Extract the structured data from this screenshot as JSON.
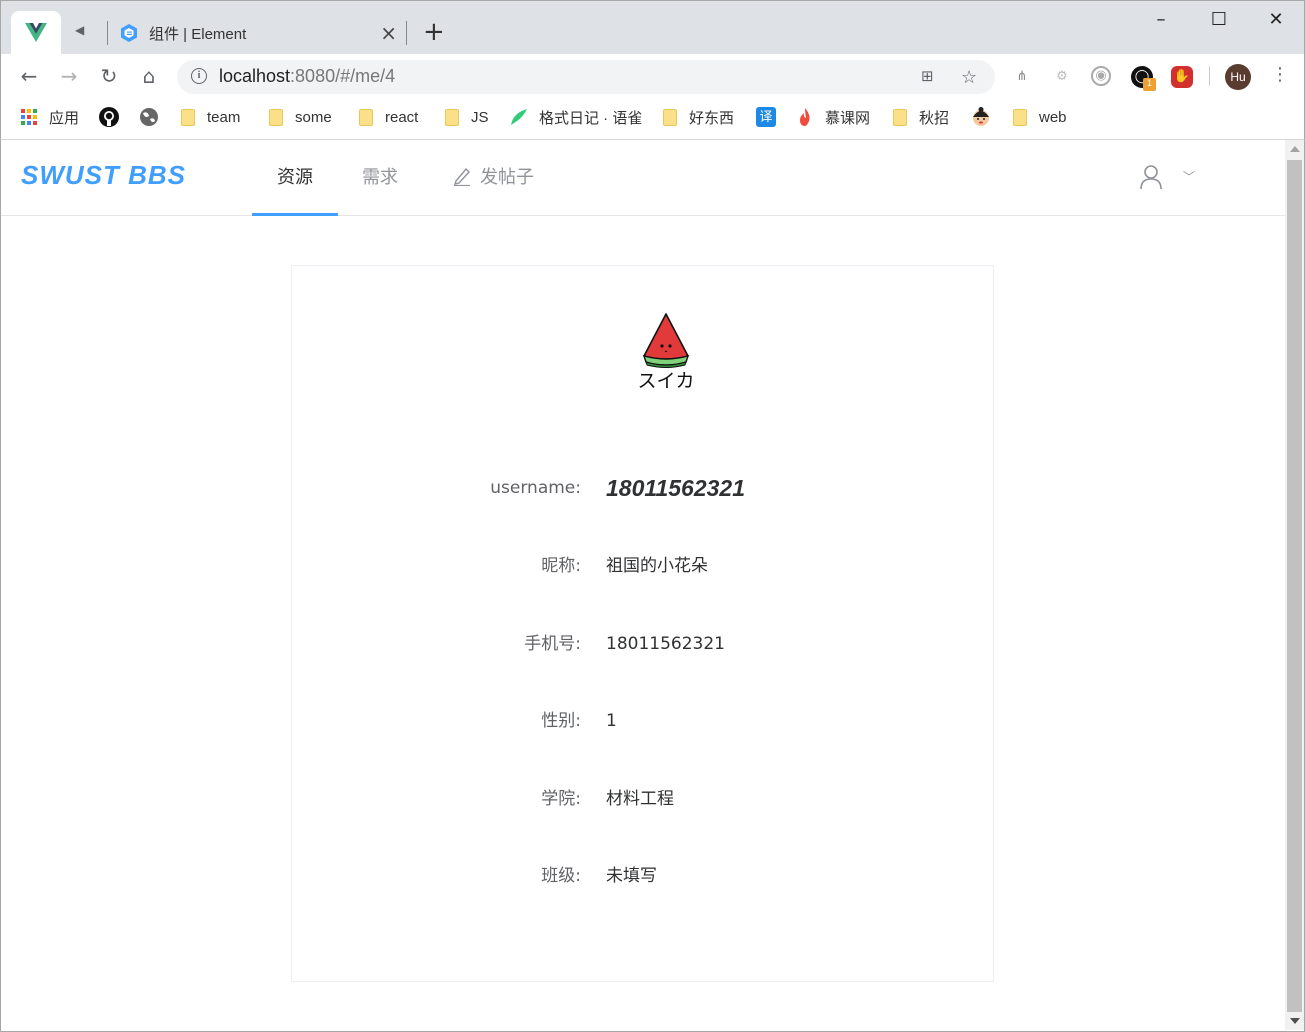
{
  "browser": {
    "tabs": [
      {
        "title": "",
        "icon": "vue-icon",
        "active": true
      },
      {
        "title": "组件 | Element",
        "icon": "element-icon",
        "active": false
      }
    ],
    "new_tab_label": "+",
    "window_controls": {
      "minimize": "–",
      "maximize": "☐",
      "close": "✕"
    },
    "url_host": "localhost",
    "url_rest": ":8080/#/me/4",
    "profile_initials": "Hu",
    "extension_badge": "1",
    "bookmarks": [
      {
        "label": "应用",
        "icon": "apps-grid-icon"
      },
      {
        "label": "",
        "icon": "github-icon"
      },
      {
        "label": "",
        "icon": "globe-icon"
      },
      {
        "label": "team",
        "icon": "folder-icon"
      },
      {
        "label": "some",
        "icon": "folder-icon"
      },
      {
        "label": "react",
        "icon": "folder-icon"
      },
      {
        "label": "JS",
        "icon": "folder-icon"
      },
      {
        "label": "格式日记 · 语雀",
        "icon": "yuque-icon"
      },
      {
        "label": "好东西",
        "icon": "folder-icon"
      },
      {
        "label": "",
        "icon": "translate-icon"
      },
      {
        "label": "慕课网",
        "icon": "flame-icon"
      },
      {
        "label": "秋招",
        "icon": "folder-icon"
      },
      {
        "label": "",
        "icon": "cartoon-icon"
      },
      {
        "label": "web",
        "icon": "folder-icon"
      }
    ],
    "translate_badge_text": "译"
  },
  "app": {
    "logo": "SWUST BBS",
    "brand_color": "#409eff",
    "nav": [
      {
        "label": "资源",
        "active": true
      },
      {
        "label": "需求",
        "active": false
      },
      {
        "label": "发帖子",
        "active": false,
        "icon": "edit-pen-icon"
      }
    ],
    "avatar_caption": "スイカ",
    "profile": [
      {
        "label": "username:",
        "value": "18011562321"
      },
      {
        "label": "昵称:",
        "value": "祖国的小花朵"
      },
      {
        "label": "手机号:",
        "value": "18011562321"
      },
      {
        "label": "性别:",
        "value": "1"
      },
      {
        "label": "学院:",
        "value": "材料工程"
      },
      {
        "label": "班级:",
        "value": "未填写"
      }
    ]
  }
}
